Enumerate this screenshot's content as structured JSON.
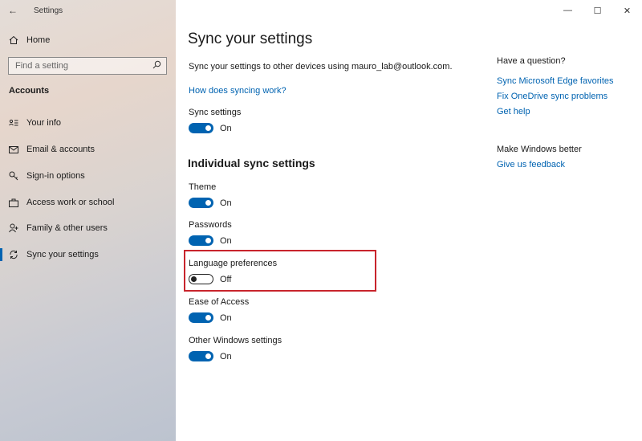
{
  "window": {
    "title": "Settings",
    "controls": {
      "minimize": "—",
      "maximize": "☐",
      "close": "✕"
    }
  },
  "sidebar": {
    "back_icon": "←",
    "home_label": "Home",
    "search_placeholder": "Find a setting",
    "section_title": "Accounts",
    "items": [
      {
        "label": "Your info",
        "icon": "person-card-icon"
      },
      {
        "label": "Email & accounts",
        "icon": "email-icon"
      },
      {
        "label": "Sign-in options",
        "icon": "key-icon"
      },
      {
        "label": "Access work or school",
        "icon": "briefcase-icon"
      },
      {
        "label": "Family & other users",
        "icon": "person-add-icon"
      },
      {
        "label": "Sync your settings",
        "icon": "sync-icon",
        "selected": true
      }
    ]
  },
  "main": {
    "title": "Sync your settings",
    "description": "Sync your settings to other devices using mauro_lab@outlook.com.",
    "how_link": "How does syncing work?",
    "sync_settings": {
      "label": "Sync settings",
      "state": "On"
    },
    "individual_heading": "Individual sync settings",
    "individual": [
      {
        "label": "Theme",
        "state": "On"
      },
      {
        "label": "Passwords",
        "state": "On"
      },
      {
        "label": "Language preferences",
        "state": "Off"
      },
      {
        "label": "Ease of Access",
        "state": "On"
      },
      {
        "label": "Other Windows settings",
        "state": "On"
      }
    ],
    "accent_color": "#0063b1",
    "highlight_color": "#c8242c"
  },
  "right": {
    "question_heading": "Have a question?",
    "links": [
      "Sync Microsoft Edge favorites",
      "Fix OneDrive sync problems",
      "Get help"
    ],
    "better_heading": "Make Windows better",
    "feedback_link": "Give us feedback"
  }
}
